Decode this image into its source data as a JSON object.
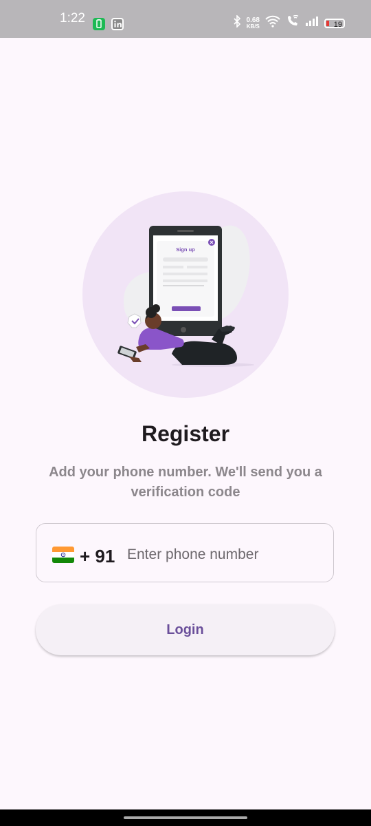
{
  "status_bar": {
    "time": "1:22",
    "net_speed_value": "0.68",
    "net_speed_unit": "KB/S",
    "battery_level": "19",
    "icons": [
      "battery-saver-icon",
      "linkedin-icon",
      "bluetooth-icon",
      "wifi-icon",
      "wifi-calling-icon",
      "signal-icon",
      "battery-icon"
    ]
  },
  "illustration": {
    "form_title": "Sign up",
    "icon": "signup-illustration"
  },
  "title": "Register",
  "subtitle": "Add your phone number. We'll send you a verification code",
  "phone_field": {
    "country_flag": "india-flag-icon",
    "country_code": "+ 91",
    "placeholder": "Enter phone number",
    "value": ""
  },
  "login_button": {
    "label": "Login"
  },
  "colors": {
    "background": "#fdf7fd",
    "accent": "#6a4f9a",
    "illustration_circle": "#f1e4f6",
    "title": "#1f1b1f",
    "subtitle": "#8c878c"
  }
}
